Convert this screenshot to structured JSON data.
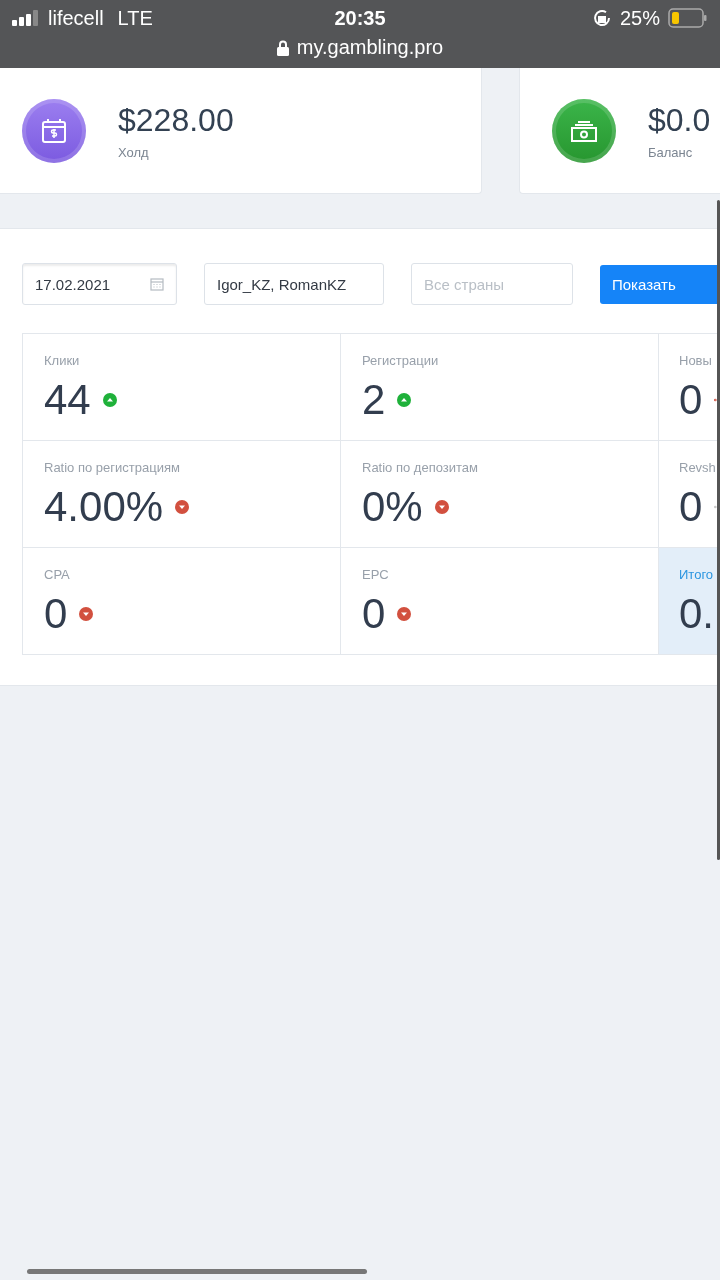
{
  "status_bar": {
    "carrier": "lifecell",
    "network": "LTE",
    "time": "20:35",
    "battery": "25%",
    "url": "my.gambling.pro"
  },
  "summary_cards": [
    {
      "kind": "hold",
      "amount": "$228.00",
      "label": "Холд"
    },
    {
      "kind": "balance",
      "amount": "$0.0",
      "label": "Баланс"
    }
  ],
  "filters": {
    "date": "17.02.2021",
    "managers": "Igor_KZ, RomanKZ",
    "countries_placeholder": "Все страны",
    "submit": "Показать"
  },
  "stats": [
    {
      "label": "Клики",
      "value": "44",
      "kind": "up",
      "highlight": false
    },
    {
      "label": "Регистрации",
      "value": "2",
      "kind": "up",
      "highlight": false
    },
    {
      "label": "Новы",
      "value": "0",
      "kind": "down",
      "highlight": false
    },
    {
      "label": "Ratio по регистрациям",
      "value": "4.00%",
      "kind": "down",
      "highlight": false
    },
    {
      "label": "Ratio по депозитам",
      "value": "0%",
      "kind": "down",
      "highlight": false
    },
    {
      "label": "Revsh",
      "value": "0",
      "kind": "neutral",
      "highlight": false
    },
    {
      "label": "CPA",
      "value": "0",
      "kind": "down",
      "highlight": false
    },
    {
      "label": "EPC",
      "value": "0",
      "kind": "down",
      "highlight": false
    },
    {
      "label": "Итого",
      "value": "0.",
      "kind": "plain",
      "highlight": true
    }
  ]
}
